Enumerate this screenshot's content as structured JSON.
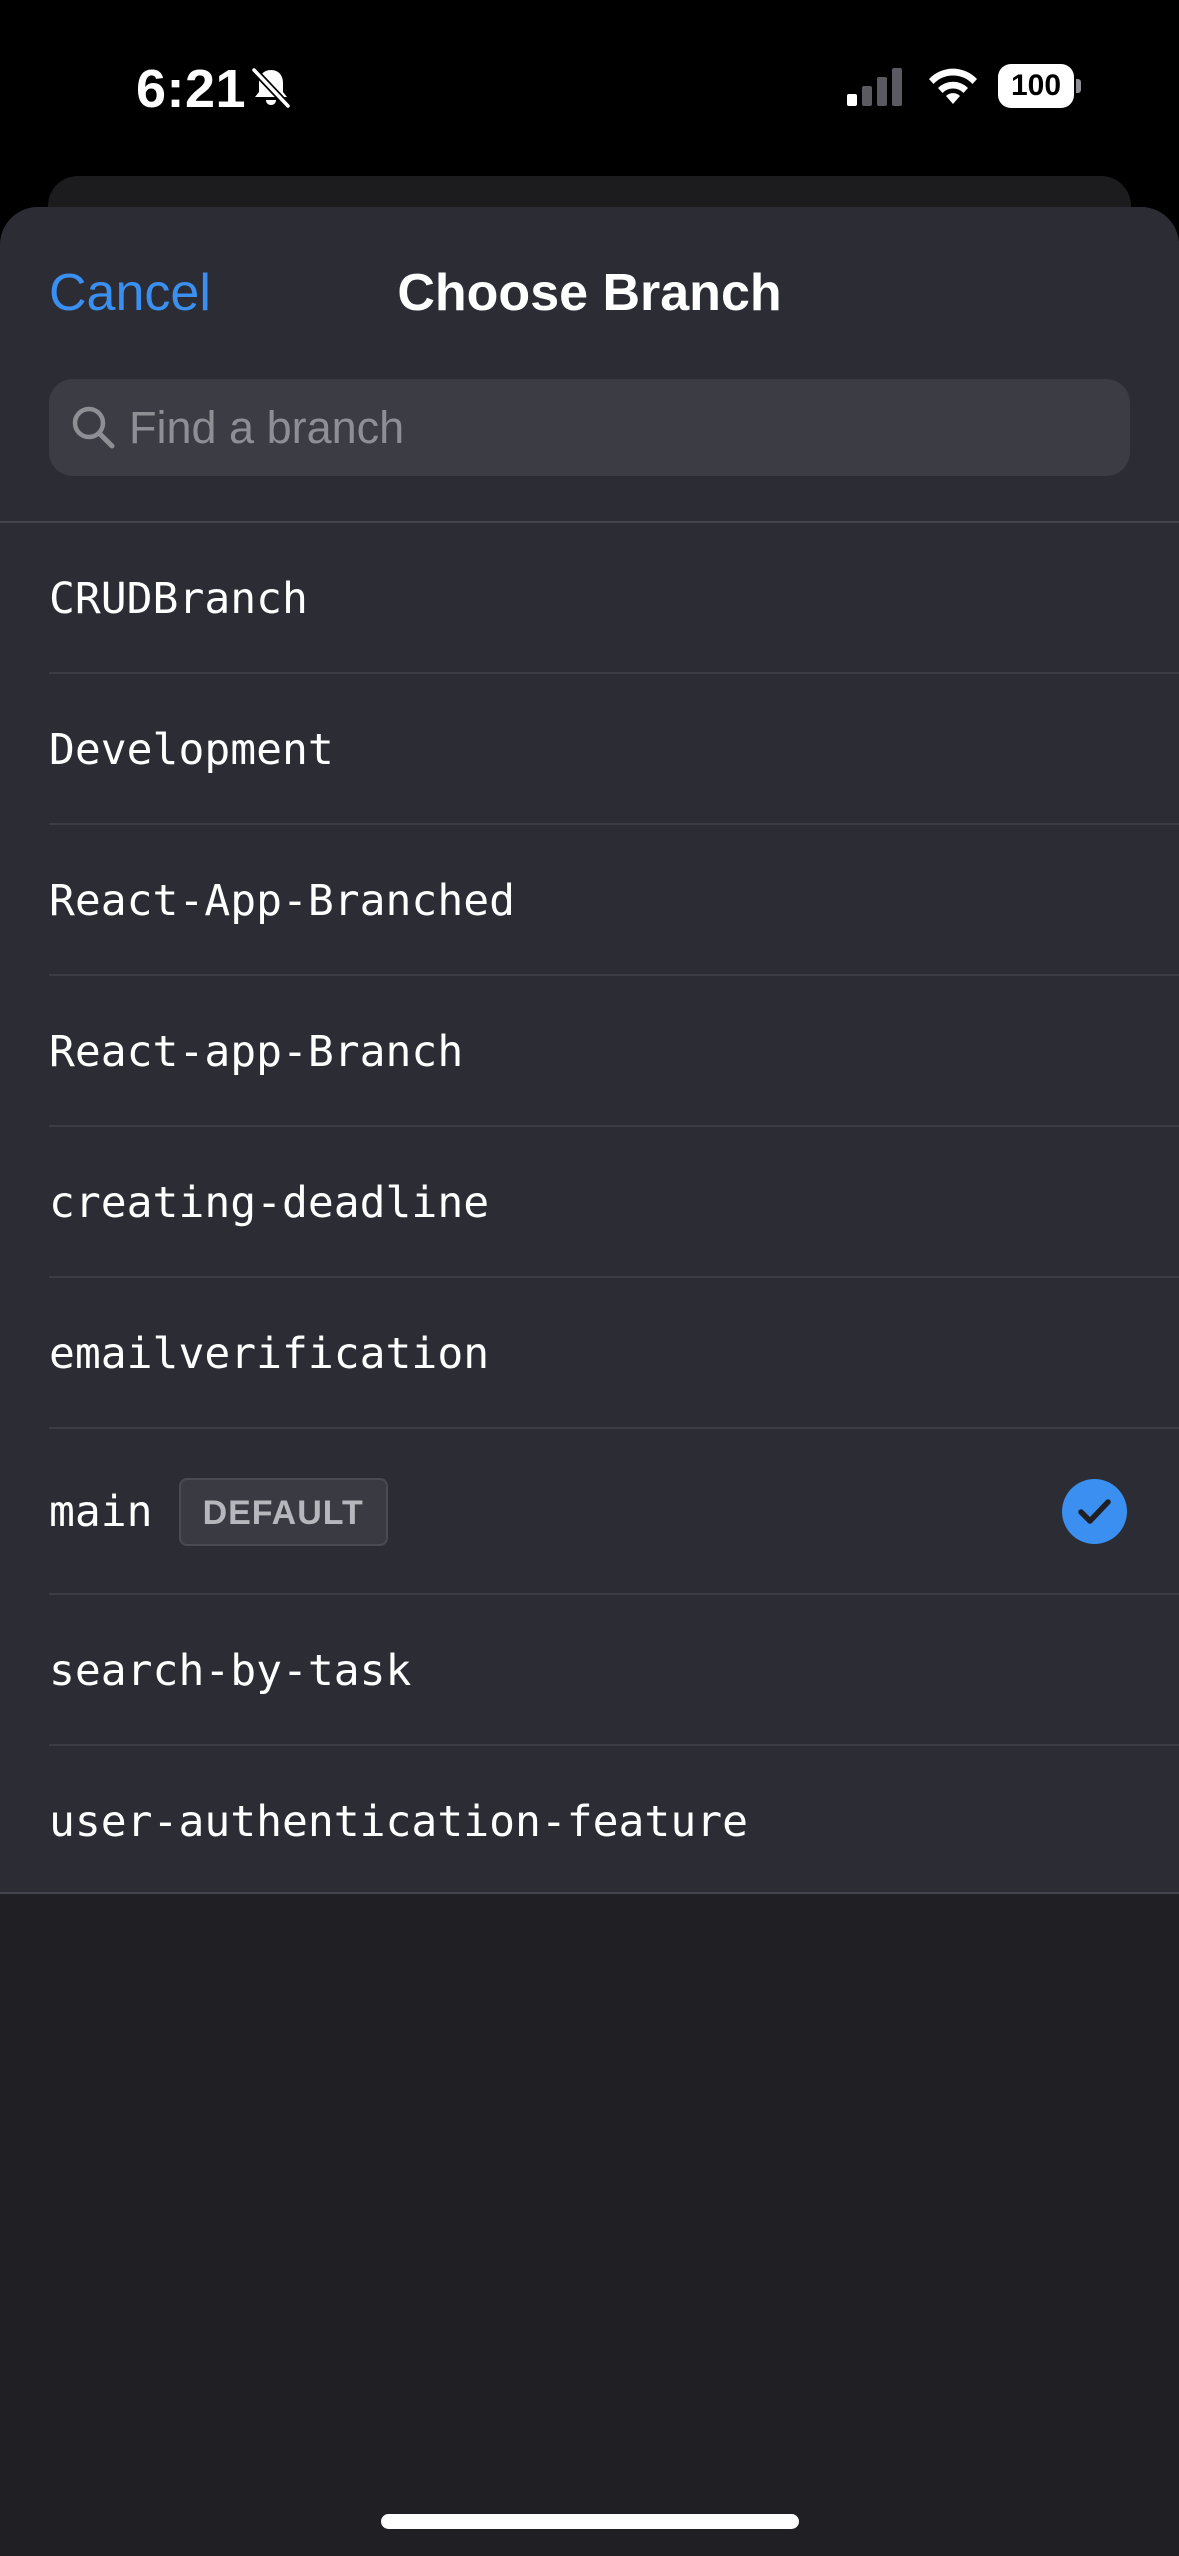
{
  "status_bar": {
    "time": "6:21",
    "battery_level": "100",
    "icons": [
      "bell-slash-icon",
      "cellular-signal-icon",
      "wifi-icon",
      "battery-icon"
    ]
  },
  "sheet": {
    "cancel_label": "Cancel",
    "title": "Choose Branch",
    "search_placeholder": "Find a branch"
  },
  "branches": [
    {
      "name": "CRUDBranch"
    },
    {
      "name": "Development"
    },
    {
      "name": "React-App-Branched"
    },
    {
      "name": "React-app-Branch"
    },
    {
      "name": "creating-deadline"
    },
    {
      "name": "emailverification"
    },
    {
      "name": "main",
      "badge": "DEFAULT",
      "selected": true
    },
    {
      "name": "search-by-task"
    },
    {
      "name": "user-authentication-feature"
    }
  ],
  "colors": {
    "accent": "#3a8ff0",
    "sheet_background": "#2c2c34",
    "page_background": "#1f1f24"
  }
}
